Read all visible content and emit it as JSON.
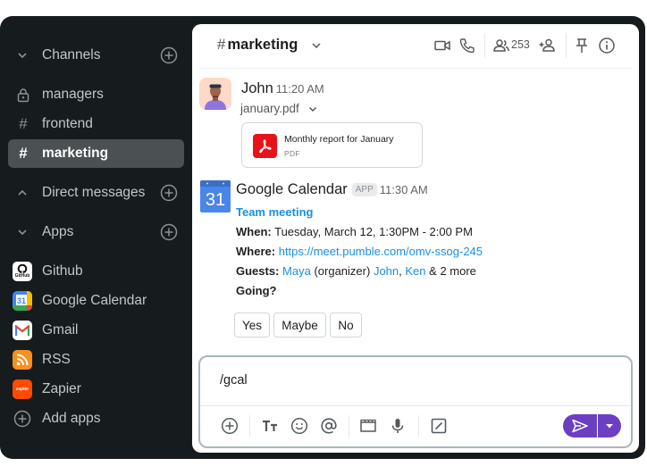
{
  "sidebar": {
    "channels_header": "Channels",
    "channels": [
      {
        "label": "managers",
        "icon": "lock-icon"
      },
      {
        "label": "frontend",
        "icon": "hash-icon"
      },
      {
        "label": "marketing",
        "icon": "hash-icon",
        "active": true
      }
    ],
    "dm_header": "Direct messages",
    "apps_header": "Apps",
    "apps": [
      {
        "label": "Github",
        "icon": "github-logo"
      },
      {
        "label": "Google Calendar",
        "icon": "google-calendar-logo"
      },
      {
        "label": "Gmail",
        "icon": "gmail-logo"
      },
      {
        "label": "RSS",
        "icon": "rss-logo"
      },
      {
        "label": "Zapier",
        "icon": "zapier-logo"
      }
    ],
    "add_apps": "Add apps",
    "github_logo_text": "GitHub",
    "gcal_logo_text": "31",
    "zapier_logo_text": "zapier"
  },
  "header": {
    "hash": "#",
    "channel_name": "marketing",
    "member_count": "253"
  },
  "messages": [
    {
      "author": "John",
      "time": "11:20 AM",
      "file_name": "january.pdf",
      "attachment": {
        "title": "Monthly report for January",
        "type": "PDF"
      }
    },
    {
      "author": "Google Calendar",
      "badge": "APP",
      "time": "11:30 AM",
      "avatar_text": "31",
      "event": {
        "title": "Team meeting",
        "when_label": "When:",
        "when": "Tuesday, March 12, 1:30PM - 2:00 PM",
        "where_label": "Where:",
        "where": "https://meet.pumble.com/omv-ssog-245",
        "guests_label": "Guests:",
        "guest_1": "Maya",
        "guest_1_note": "(organizer)",
        "guest_2": "John",
        "guest_sep": ",",
        "guest_3": "Ken",
        "guests_more": "& 2 more",
        "going_label": "Going?",
        "rsvp": [
          "Yes",
          "Maybe",
          "No"
        ]
      }
    }
  ],
  "composer": {
    "value": "/gcal",
    "placeholder": ""
  },
  "colors": {
    "accent": "#6c3fc2",
    "link": "#1a8fe3",
    "sidebar_bg": "#161b1e",
    "active_channel": "#4b5053"
  }
}
